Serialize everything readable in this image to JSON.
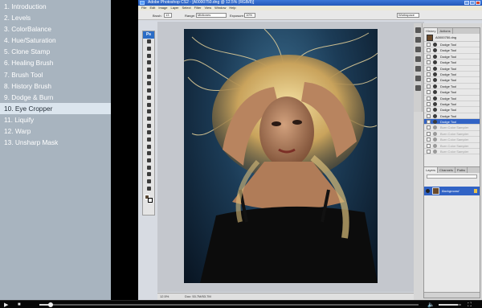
{
  "lessons": [
    {
      "label": "1. Introduction"
    },
    {
      "label": "2. Levels"
    },
    {
      "label": "3. ColorBalance"
    },
    {
      "label": "4. Hue/Saturation"
    },
    {
      "label": "5. Clone Stamp"
    },
    {
      "label": "6. Healing Brush"
    },
    {
      "label": "7. Brush Tool"
    },
    {
      "label": "8. History Brush"
    },
    {
      "label": "9. Dodge & Burn"
    },
    {
      "label": "10. Eye Cropper",
      "active": true
    },
    {
      "label": "11. Liquify"
    },
    {
      "label": "12. Warp"
    },
    {
      "label": "13. Unsharp Mask"
    }
  ],
  "photoshop": {
    "title": "Adobe Photoshop CS2 - [A0000750.dng @ 12.5% (RGB/8)]",
    "menu": [
      "File",
      "Edit",
      "Image",
      "Layer",
      "Select",
      "Filter",
      "View",
      "Window",
      "Help"
    ],
    "options": {
      "brush_label": "Brush:",
      "brush_size": "13",
      "range_label": "Range:",
      "range_value": "Midtones",
      "exposure_label": "Exposure:",
      "exposure_value": "10%",
      "workspace": "Workspace"
    },
    "logo": "Ps",
    "status": {
      "zoom": "12.5%",
      "doc": "Doc: 53.7M/53.7M"
    },
    "history": {
      "tabs": [
        "History",
        "Actions"
      ],
      "snapshot": "A0000750.dng",
      "steps": [
        {
          "label": "Dodge Tool"
        },
        {
          "label": "Dodge Tool"
        },
        {
          "label": "Dodge Tool"
        },
        {
          "label": "Dodge Tool"
        },
        {
          "label": "Dodge Tool"
        },
        {
          "label": "Dodge Tool"
        },
        {
          "label": "Dodge Tool"
        },
        {
          "label": "Dodge Tool"
        },
        {
          "label": "Dodge Tool"
        },
        {
          "label": "Dodge Tool"
        },
        {
          "label": "Dodge Tool"
        },
        {
          "label": "Dodge Tool"
        },
        {
          "label": "Dodge Tool"
        },
        {
          "label": "Dodge Tool",
          "selected": true
        },
        {
          "label": "Burn Color Sampler",
          "dim": true
        },
        {
          "label": "Burn Color Sampler",
          "dim": true
        },
        {
          "label": "Burn Color Sampler",
          "dim": true
        },
        {
          "label": "Burn Color Sampler",
          "dim": true
        },
        {
          "label": "Burn Color Sampler",
          "dim": true
        }
      ]
    },
    "layers": {
      "tabs": [
        "Layers",
        "Channels",
        "Paths"
      ],
      "layer_name": "Background"
    },
    "colors": {
      "foreground": "#5b4a37",
      "background": "#ffffff",
      "selection": "#3163c5"
    }
  },
  "player": {
    "play_icon": "play-icon",
    "stop_icon": "stop-icon",
    "progress_fraction": 0.03,
    "volume_fraction": 0.85,
    "icons": [
      "play-icon",
      "stop-icon",
      "volume-icon",
      "fullscreen-icon"
    ]
  }
}
